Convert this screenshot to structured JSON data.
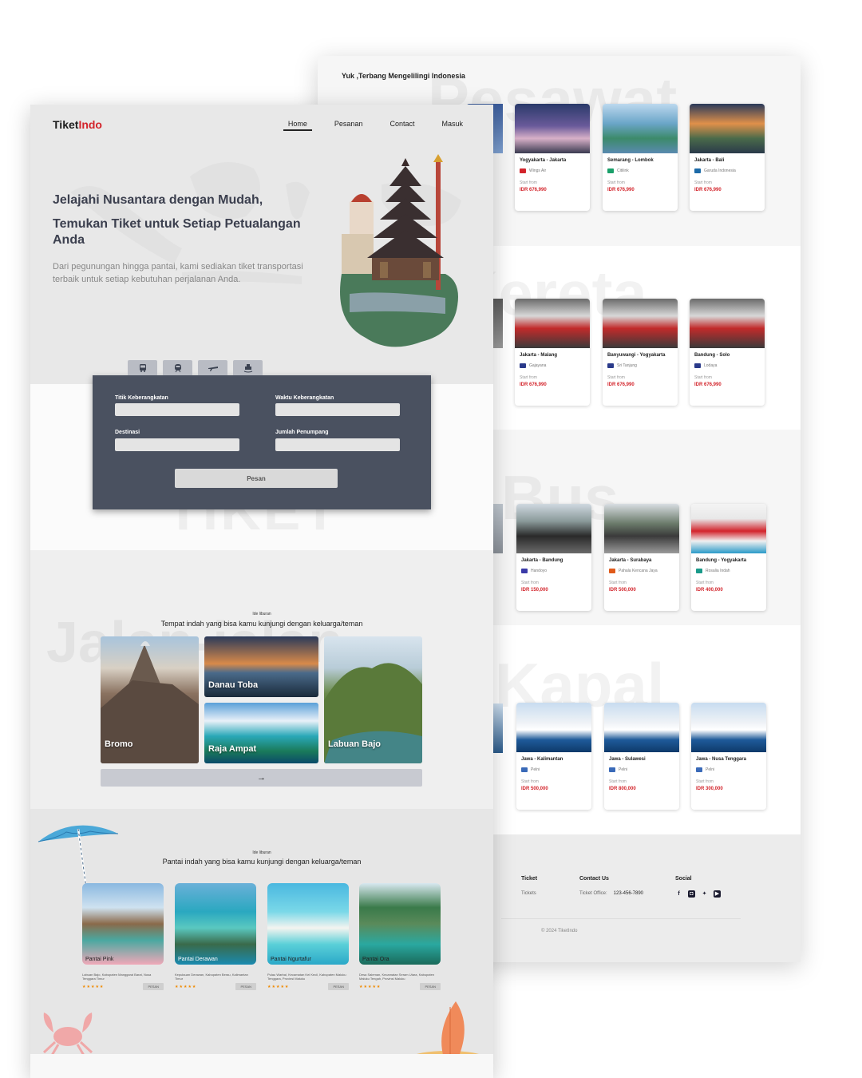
{
  "back": {
    "intro": "Yuk ,Terbang Mengelilingi Indonesia",
    "watermarks": [
      "Pesawat",
      "Kereta",
      "Bus",
      "Kapal"
    ],
    "sections": [
      {
        "cards": [
          {
            "route": "Yogyakarta - Jakarta",
            "operator": "Wings Air",
            "start": "Start from",
            "price": "IDR 676,990"
          },
          {
            "route": "Semarang - Lombok",
            "operator": "Citilink",
            "start": "Start from",
            "price": "IDR 676,990"
          },
          {
            "route": "Jakarta - Bali",
            "operator": "Garuda Indonesia",
            "start": "Start from",
            "price": "IDR 676,990"
          }
        ]
      },
      {
        "cards": [
          {
            "route": "Jakarta - Malang",
            "operator": "Gajayana",
            "start": "Start from",
            "price": "IDR 676,990"
          },
          {
            "route": "Banyuwangi - Yogyakarta",
            "operator": "Sri Tanjung",
            "start": "Start from",
            "price": "IDR 676,990"
          },
          {
            "route": "Bandung - Solo",
            "operator": "Lodaya",
            "start": "Start from",
            "price": "IDR 676,990"
          }
        ]
      },
      {
        "cards": [
          {
            "route": "Jakarta - Bandung",
            "operator": "Handoyo",
            "start": "Start from",
            "price": "IDR 150,000"
          },
          {
            "route": "Jakarta - Surabaya",
            "operator": "Pahala Kencana Jaya",
            "start": "Start from",
            "price": "IDR 500,000"
          },
          {
            "route": "Bandung - Yogyakarta",
            "operator": "Rosalia Indah",
            "start": "Start from",
            "price": "IDR 400,000"
          }
        ]
      },
      {
        "cards": [
          {
            "route": "Jawa - Kalimantan",
            "operator": "Pelni",
            "start": "Start from",
            "price": "IDR 500,000"
          },
          {
            "route": "Jawa - Sulawesi",
            "operator": "Pelni",
            "start": "Start from",
            "price": "IDR 800,000"
          },
          {
            "route": "Jawa - Nusa Tenggara",
            "operator": "Pelni",
            "start": "Start from",
            "price": "IDR 300,000"
          }
        ]
      }
    ],
    "footer": {
      "ticket_heading": "Ticket",
      "ticket_link": "Tickets",
      "contact_heading": "Contact Us",
      "contact_label": "Ticket Office:",
      "contact_phone": "123-456-7890",
      "social_heading": "Social",
      "copyright": "© 2024 TiketIndo"
    }
  },
  "front": {
    "logo_part1": "Tiket",
    "logo_part2": "Indo",
    "nav": [
      "Home",
      "Pesanan",
      "Contact",
      "Masuk"
    ],
    "headline1": "Jelajahi Nusantara dengan Mudah,",
    "headline2": "Temukan Tiket untuk Setiap Petualangan Anda",
    "subtext": "Dari pegunungan hingga pantai, kami sediakan tiket transportasi terbaik untuk setiap kebutuhan perjalanan Anda.",
    "transport_icons": [
      "bus-icon",
      "train-icon",
      "plane-icon",
      "ship-icon"
    ],
    "form": {
      "origin_label": "Titik Keberangkatan",
      "time_label": "Waktu Keberangkatan",
      "dest_label": "Destinasi",
      "passengers_label": "Jumlah Penumpang",
      "submit": "Pesan"
    },
    "tiket_watermark": "TIKET",
    "destinations": {
      "kicker": "Ide liburan",
      "title": "Tempat indah yang bisa kamu kunjungi dengan keluarga/teman",
      "watermark": "Jalan-jalan",
      "places": [
        "Bromo",
        "Danau Toba",
        "Raja Ampat",
        "Labuan Bajo"
      ],
      "more": "→"
    },
    "beaches": {
      "kicker": "Ide liburan",
      "title": "Pantai indah yang bisa kamu kunjungi dengan keluarga/teman",
      "items": [
        {
          "name": "Pantai Pink",
          "desc": "Labuan Bajo, Kabupaten Manggarai Barat, Nusa Tenggara Timur",
          "stars": "★★★★★",
          "button": "PESAN"
        },
        {
          "name": "Pantai Derawan",
          "desc": "Kepulauan Derawan, Kabupaten Berau, Kalimantan Timur",
          "stars": "★★★★★",
          "button": "PESAN"
        },
        {
          "name": "Pantai Ngurtafur",
          "desc": "Pulau Warbal, Kecamatan Kei Kecil, Kabupaten Maluku Tenggara, Provinsi Maluku",
          "stars": "★★★★★",
          "button": "PESAN"
        },
        {
          "name": "Pantai Ora",
          "desc": "Desa Saleman, Kecamatan Seram Utara, Kabupaten Maluku Tengah, Provinsi Maluku",
          "stars": "★★★★★",
          "button": "PESAN"
        }
      ]
    }
  }
}
